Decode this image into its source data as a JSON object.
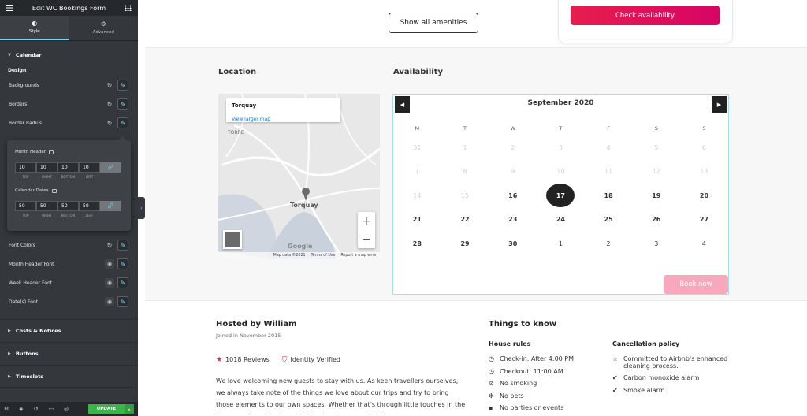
{
  "editor": {
    "title": "Edit WC Bookings Form",
    "tabs": [
      {
        "label": "Style"
      },
      {
        "label": "Advanced"
      }
    ],
    "section_calendar": "Calendar",
    "design_label": "Design",
    "controls": [
      "Backgrounds",
      "Borders",
      "Border Radius"
    ],
    "popover": {
      "month_header_label": "Month Header",
      "month_header_values": [
        "10",
        "10",
        "10",
        "10"
      ],
      "calendar_dates_label": "Calendar Dates",
      "calendar_dates_values": [
        "50",
        "50",
        "50",
        "50"
      ],
      "captions": [
        "TOP",
        "RIGHT",
        "BOTTOM",
        "LEFT"
      ]
    },
    "controls2": [
      "Font Colors",
      "Month Header Font",
      "Week Header Font",
      "Date(s) Font"
    ],
    "sections": [
      "Costs & Notices",
      "Buttons",
      "Timeslots"
    ],
    "update_label": "UPDATE"
  },
  "page": {
    "amenities_button": "Show all amenities",
    "check_availability": "Check availability",
    "location_title": "Location",
    "availability_title": "Availability",
    "map": {
      "place": "Torquay",
      "view_larger": "View larger map",
      "labels": [
        "TORRE",
        "Torquay"
      ],
      "footer": [
        "Map data ©2021",
        "Terms of Use",
        "Report a map error"
      ],
      "google": "Google"
    },
    "calendar": {
      "month": "September 2020",
      "weekdays": [
        "M",
        "T",
        "W",
        "T",
        "F",
        "S",
        "S"
      ],
      "weeks": [
        [
          "31",
          "1",
          "2",
          "3",
          "4",
          "5",
          "6"
        ],
        [
          "7",
          "8",
          "9",
          "10",
          "11",
          "12",
          "13"
        ],
        [
          "14",
          "15",
          "16",
          "17",
          "18",
          "19",
          "20"
        ],
        [
          "21",
          "22",
          "23",
          "24",
          "25",
          "26",
          "27"
        ],
        [
          "28",
          "29",
          "30",
          "1",
          "2",
          "3",
          "4"
        ]
      ],
      "book_now": "Book now"
    },
    "host": {
      "title": "Hosted by William",
      "joined": "Joined in November 2015",
      "reviews": "1018 Reviews",
      "verified": "Identity Verified",
      "description": "We love welcoming new guests to stay with us. As keen travellers ourselves, we always take note of the things we love about our trips and try to bring those elements to our own spaces. Whether that's through little touches in the house or always being available should you need help"
    },
    "things": {
      "title": "Things to know",
      "rules_title": "House rules",
      "rules": [
        "Check-in: After 4:00 PM",
        "Checkout: 11:00 AM",
        "No smoking",
        "No pets",
        "No parties or events"
      ],
      "cancel_title": "Cancellation policy",
      "cancel": [
        "Committed to Airbnb's enhanced cleaning process.",
        "Carbon monoxide alarm",
        "Smoke alarm"
      ]
    }
  }
}
